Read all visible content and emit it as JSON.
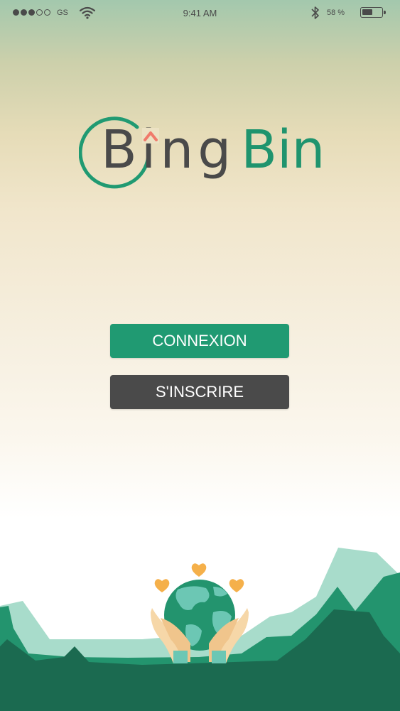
{
  "status_bar": {
    "carrier": "GS",
    "time": "9:41 AM",
    "battery_percent": "58 %",
    "battery_level": 0.58,
    "signal_bars_filled": 3,
    "signal_bars_total": 5
  },
  "logo": {
    "part1": "Bing",
    "part2": "Bin",
    "icons": [
      "logo-ring-icon",
      "logo-arrow-icon"
    ]
  },
  "buttons": {
    "login_label": "CONNEXION",
    "register_label": "S'INSCRIRE"
  },
  "illustration": {
    "icons": [
      "globe-icon",
      "hands-icon",
      "heart-icon",
      "mountains-icon"
    ]
  },
  "colors": {
    "brand_green": "#209a72",
    "dark_gray": "#4a4a4a",
    "accent_coral": "#f07a6b",
    "heart_orange": "#f5b04a"
  }
}
